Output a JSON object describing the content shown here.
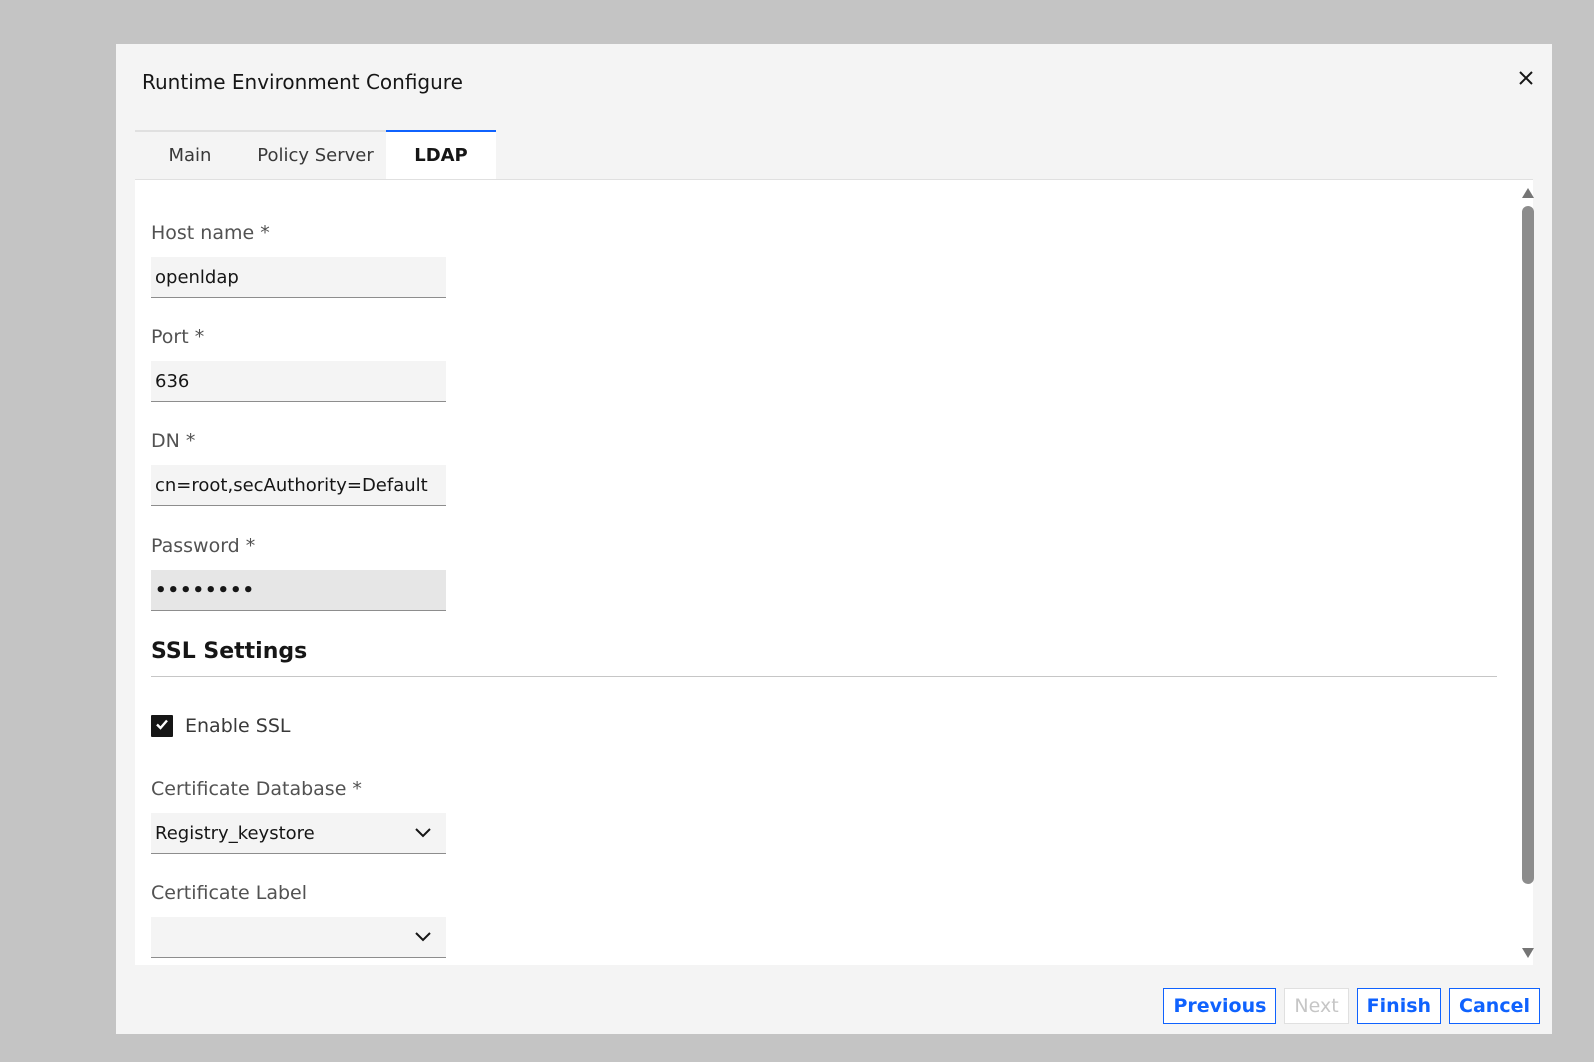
{
  "dialog": {
    "title": "Runtime Environment Configure",
    "close_icon": "close-icon"
  },
  "tabs": [
    {
      "label": "Main",
      "active": false
    },
    {
      "label": "Policy Server",
      "active": false
    },
    {
      "label": "LDAP",
      "active": true
    }
  ],
  "form": {
    "host_name": {
      "label": "Host name *",
      "value": "openldap"
    },
    "port": {
      "label": "Port *",
      "value": "636"
    },
    "dn": {
      "label": "DN *",
      "value": "cn=root,secAuthority=Default"
    },
    "password": {
      "label": "Password *",
      "value": "••••••••"
    }
  },
  "ssl": {
    "section_title": "SSL Settings",
    "enable_ssl": {
      "label": "Enable SSL",
      "checked": true
    },
    "certificate_database": {
      "label": "Certificate Database *",
      "value": "Registry_keystore"
    },
    "certificate_label": {
      "label": "Certificate Label",
      "value": ""
    }
  },
  "footer": {
    "previous": "Previous",
    "next": "Next",
    "finish": "Finish",
    "cancel": "Cancel"
  },
  "colors": {
    "accent": "#0f62fe",
    "backdrop": "#c4c4c4",
    "dialog_bg": "#f4f4f4"
  }
}
